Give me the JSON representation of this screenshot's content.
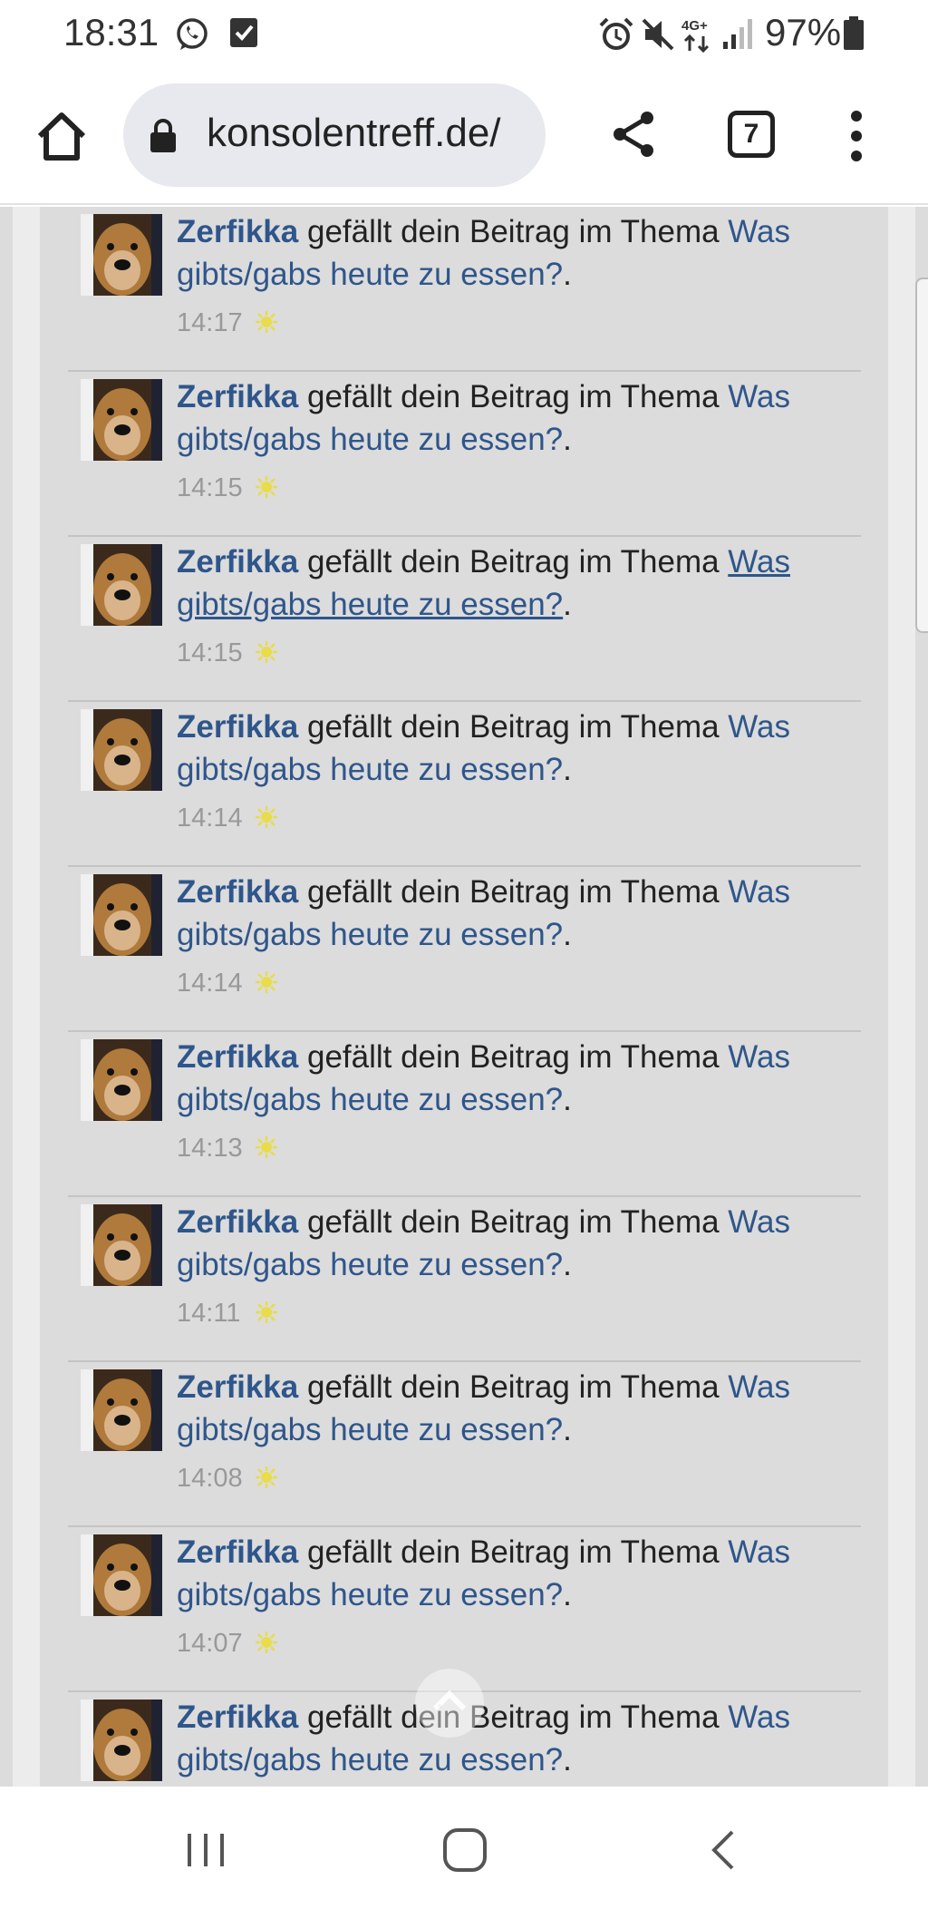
{
  "status_bar": {
    "time": "18:31",
    "icons": [
      "whatsapp-icon",
      "checkbox-notification-icon",
      "alarm-icon",
      "mute-icon",
      "4g-data-icon",
      "signal-icon",
      "battery-icon"
    ],
    "battery_percent": "97%",
    "network_label": "4G+"
  },
  "browser": {
    "url": "konsolentreff.de/",
    "tab_count": "7",
    "icons": [
      "home-icon",
      "lock-icon",
      "share-icon",
      "tabs-icon",
      "more-icon"
    ]
  },
  "notifications": [
    {
      "user": "Zerfikka",
      "action": " gefällt dein Beitrag im Thema ",
      "topic": "Was gibts/gabs heute zu essen?",
      "end": ".",
      "time": "14:17",
      "underlined": false
    },
    {
      "user": "Zerfikka",
      "action": " gefällt dein Beitrag im Thema ",
      "topic": "Was gibts/gabs heute zu essen?",
      "end": ".",
      "time": "14:15",
      "underlined": false
    },
    {
      "user": "Zerfikka",
      "action": " gefällt dein Beitrag im Thema ",
      "topic": "Was gibts/gabs heute zu essen?",
      "end": ".",
      "time": "14:15",
      "underlined": true
    },
    {
      "user": "Zerfikka",
      "action": " gefällt dein Beitrag im Thema ",
      "topic": "Was gibts/gabs heute zu essen?",
      "end": ".",
      "time": "14:14",
      "underlined": false
    },
    {
      "user": "Zerfikka",
      "action": " gefällt dein Beitrag im Thema ",
      "topic": "Was gibts/gabs heute zu essen?",
      "end": ".",
      "time": "14:14",
      "underlined": false
    },
    {
      "user": "Zerfikka",
      "action": " gefällt dein Beitrag im Thema ",
      "topic": "Was gibts/gabs heute zu essen?",
      "end": ".",
      "time": "14:13",
      "underlined": false
    },
    {
      "user": "Zerfikka",
      "action": " gefällt dein Beitrag im Thema ",
      "topic": "Was gibts/gabs heute zu essen?",
      "end": ".",
      "time": "14:11",
      "underlined": false
    },
    {
      "user": "Zerfikka",
      "action": " gefällt dein Beitrag im Thema ",
      "topic": "Was gibts/gabs heute zu essen?",
      "end": ".",
      "time": "14:08",
      "underlined": false
    },
    {
      "user": "Zerfikka",
      "action": " gefällt dein Beitrag im Thema ",
      "topic": "Was gibts/gabs heute zu essen?",
      "end": ".",
      "time": "14:07",
      "underlined": false
    },
    {
      "user": "Zerfikka",
      "action": " gefällt dein Beitrag im Thema ",
      "topic": "Was gibts/gabs heute zu essen?",
      "end": ".",
      "time": "",
      "underlined": false
    }
  ],
  "nav_bar": {
    "icons": [
      "recent-apps-icon",
      "home-nav-icon",
      "back-icon"
    ]
  },
  "colors": {
    "link": "#2f568b",
    "content_bg": "#dcdcdc",
    "timestamp": "#999999",
    "url_pill": "#e8e9ee"
  }
}
